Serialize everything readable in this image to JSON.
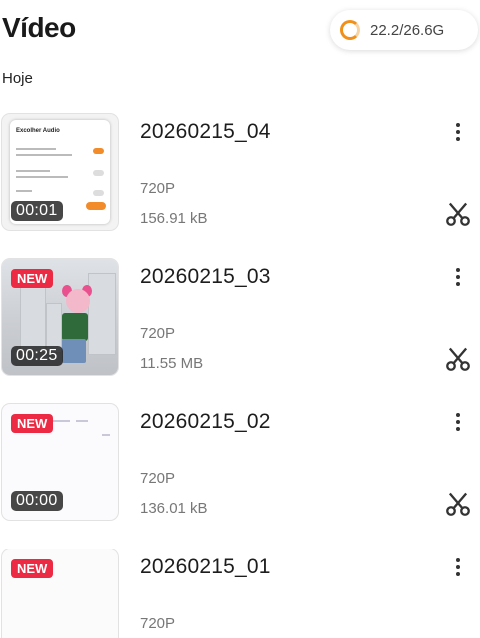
{
  "header": {
    "title": "Vídeo",
    "storage_text": "22.2/26.6G"
  },
  "section": {
    "label": "Hoje"
  },
  "colors": {
    "accent": "#f0901a",
    "new_badge": "#ec2a43"
  },
  "icons": {
    "more": "more-vertical-icon",
    "cut": "scissors-icon",
    "storage": "storage-ring-icon"
  },
  "videos": [
    {
      "name": "20260215_04",
      "resolution": "720P",
      "size": "156.91 kB",
      "duration": "00:01",
      "badge": "",
      "thumb": {
        "title": "Excolher Audio"
      }
    },
    {
      "name": "20260215_03",
      "resolution": "720P",
      "size": "11.55 MB",
      "duration": "00:25",
      "badge": "NEW"
    },
    {
      "name": "20260215_02",
      "resolution": "720P",
      "size": "136.01 kB",
      "duration": "00:00",
      "badge": "NEW"
    },
    {
      "name": "20260215_01",
      "resolution": "720P",
      "size": "",
      "duration": "",
      "badge": "NEW"
    }
  ]
}
